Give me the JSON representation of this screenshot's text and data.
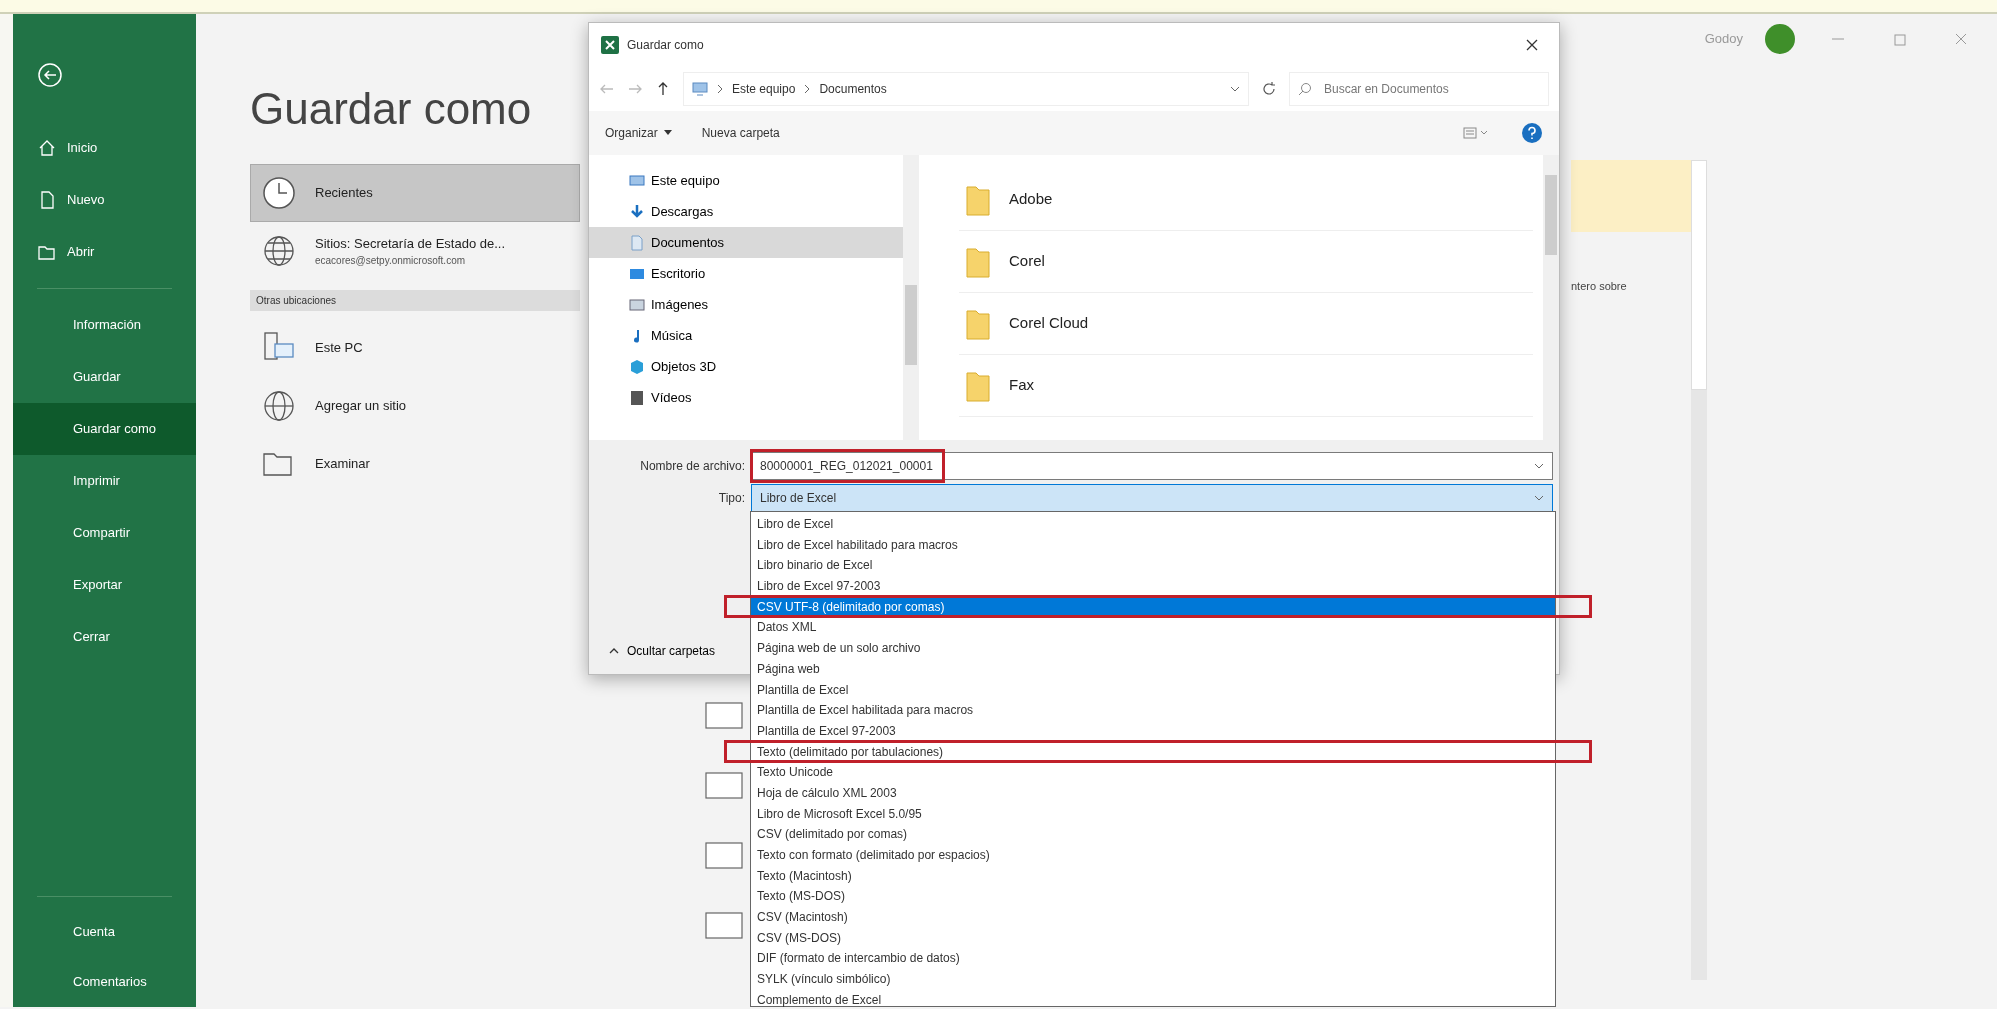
{
  "window": {
    "user_name": "Godoy"
  },
  "sidebar": {
    "top_items": [
      {
        "label": "Inicio"
      },
      {
        "label": "Nuevo"
      },
      {
        "label": "Abrir"
      }
    ],
    "items": [
      {
        "label": "Información",
        "selected": false
      },
      {
        "label": "Guardar",
        "selected": false
      },
      {
        "label": "Guardar como",
        "selected": true
      },
      {
        "label": "Imprimir",
        "selected": false
      },
      {
        "label": "Compartir",
        "selected": false
      },
      {
        "label": "Exportar",
        "selected": false
      },
      {
        "label": "Cerrar",
        "selected": false
      }
    ],
    "bottom_items": [
      {
        "label": "Cuenta"
      },
      {
        "label": "Comentarios"
      }
    ]
  },
  "backstage": {
    "title": "Guardar como",
    "locations": [
      {
        "label": "Recientes",
        "selected": true
      },
      {
        "label": "Sitios: Secretaría de Estado de...",
        "sublabel": "ecacores@setpy.onmicrosoft.com",
        "selected": false
      }
    ],
    "other_header": "Otras ubicaciones",
    "other_locations": [
      {
        "label": "Este PC"
      },
      {
        "label": "Agregar un sitio"
      },
      {
        "label": "Examinar"
      }
    ],
    "right_pane_text": "ntero sobre"
  },
  "dialog": {
    "title": "Guardar como",
    "breadcrumb": [
      "Este equipo",
      "Documentos"
    ],
    "search_placeholder": "Buscar en Documentos",
    "toolbar": [
      "Organizar",
      "Nueva carpeta"
    ],
    "nav_items": [
      {
        "label": "Este equipo",
        "selected": false
      },
      {
        "label": "Descargas",
        "selected": false
      },
      {
        "label": "Documentos",
        "selected": true
      },
      {
        "label": "Escritorio",
        "selected": false
      },
      {
        "label": "Imágenes",
        "selected": false
      },
      {
        "label": "Música",
        "selected": false
      },
      {
        "label": "Objetos 3D",
        "selected": false
      },
      {
        "label": "Vídeos",
        "selected": false
      }
    ],
    "files": [
      "Adobe",
      "Corel",
      "Corel Cloud",
      "Fax"
    ],
    "file_name_label": "Nombre de archivo:",
    "file_name": "80000001_REG_012021_00001",
    "file_name_annotated": true,
    "type_label": "Tipo:",
    "type_value": "Libro de Excel",
    "hide_folders": "Ocultar carpetas",
    "type_options": [
      {
        "label": "Libro de Excel",
        "selected": false,
        "annotated": false
      },
      {
        "label": "Libro de Excel habilitado para macros",
        "selected": false,
        "annotated": false
      },
      {
        "label": "Libro binario de Excel",
        "selected": false,
        "annotated": false
      },
      {
        "label": "Libro de Excel 97-2003",
        "selected": false,
        "annotated": false
      },
      {
        "label": "CSV UTF-8 (delimitado por comas)",
        "selected": true,
        "annotated": true
      },
      {
        "label": "Datos XML",
        "selected": false,
        "annotated": false
      },
      {
        "label": "Página web de un solo archivo",
        "selected": false,
        "annotated": false
      },
      {
        "label": "Página web",
        "selected": false,
        "annotated": false
      },
      {
        "label": "Plantilla de Excel",
        "selected": false,
        "annotated": false
      },
      {
        "label": "Plantilla de Excel habilitada para macros",
        "selected": false,
        "annotated": false
      },
      {
        "label": "Plantilla de Excel 97-2003",
        "selected": false,
        "annotated": false
      },
      {
        "label": "Texto (delimitado por tabulaciones)",
        "selected": false,
        "annotated": true
      },
      {
        "label": "Texto Unicode",
        "selected": false,
        "annotated": false
      },
      {
        "label": "Hoja de cálculo XML 2003",
        "selected": false,
        "annotated": false
      },
      {
        "label": "Libro de Microsoft Excel 5.0/95",
        "selected": false,
        "annotated": false
      },
      {
        "label": "CSV (delimitado por comas)",
        "selected": false,
        "annotated": false
      },
      {
        "label": "Texto con formato (delimitado por espacios)",
        "selected": false,
        "annotated": false
      },
      {
        "label": "Texto (Macintosh)",
        "selected": false,
        "annotated": false
      },
      {
        "label": "Texto (MS-DOS)",
        "selected": false,
        "annotated": false
      },
      {
        "label": "CSV (Macintosh)",
        "selected": false,
        "annotated": false
      },
      {
        "label": "CSV (MS-DOS)",
        "selected": false,
        "annotated": false
      },
      {
        "label": "DIF (formato de intercambio de datos)",
        "selected": false,
        "annotated": false
      },
      {
        "label": "SYLK (vínculo simbólico)",
        "selected": false,
        "annotated": false
      },
      {
        "label": "Complemento de Excel",
        "selected": false,
        "annotated": false
      }
    ]
  }
}
